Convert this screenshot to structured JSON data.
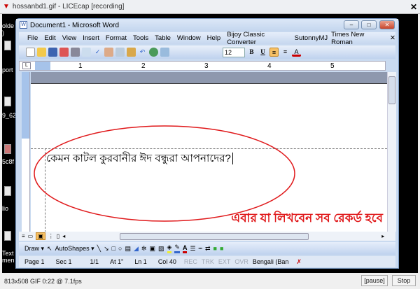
{
  "licecap": {
    "title": "hossanbd1.gif - LICEcap [recording]",
    "close": "✕",
    "info": "813x508 GIF 0:22 @ 7.1fps",
    "pause": "[pause]",
    "stop": "Stop"
  },
  "desktop": [
    "olde",
    ")",
    "port",
    "9_62",
    "5c8f",
    "lio",
    "Text",
    "men"
  ],
  "word": {
    "title": "Document1 - Microsoft Word",
    "menu": [
      "File",
      "Edit",
      "View",
      "Insert",
      "Format",
      "Tools",
      "Table",
      "Window",
      "Help",
      "Bijoy Classic Converter",
      "SutonnyMJ",
      "Times New Roman"
    ],
    "menu_close": "✕",
    "font_size": "12",
    "bold": "B",
    "underline": "U",
    "font_color": "A",
    "ruler_numbers": [
      "1",
      "2",
      "3",
      "4",
      "5"
    ],
    "document_text": "কেমন কাটল কুরবানীর ঈদ বন্ধুরা আপনাদের?",
    "overlay_text": "এবার যা লিখবেন সব রেকর্ড হবে",
    "draw": "Draw ▾",
    "autoshapes": "AutoShapes ▾",
    "status": {
      "page": "Page 1",
      "sec": "Sec 1",
      "pages": "1/1",
      "at": "At 1\"",
      "ln": "Ln 1",
      "col": "Col 40",
      "rec": "REC",
      "trk": "TRK",
      "ext": "EXT",
      "ovr": "OVR",
      "lang": "Bengali (Ban"
    }
  },
  "colors": {
    "annotation": "#e0191b",
    "word_chrome": "#c9daf0"
  }
}
